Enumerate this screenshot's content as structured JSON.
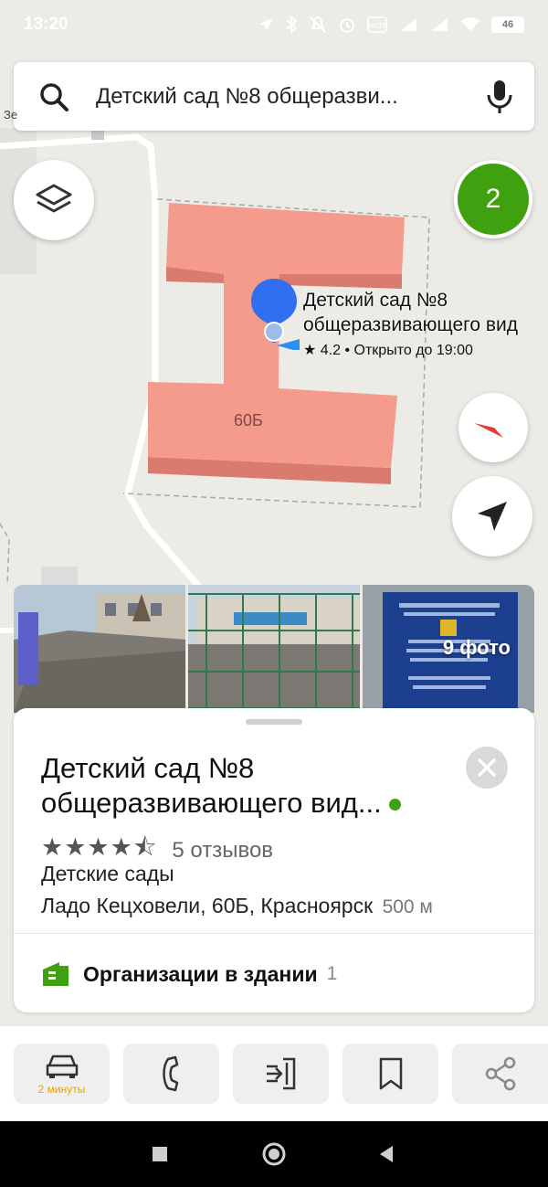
{
  "status_bar": {
    "time": "13:20",
    "battery": "46",
    "icons": [
      "location-arrow-icon",
      "bluetooth-icon",
      "mute-icon",
      "alarm-icon",
      "volte-icon",
      "signal-icon",
      "signal-icon",
      "wifi-icon",
      "battery-icon"
    ]
  },
  "search": {
    "query": "Детский сад №8 общеразви...",
    "icons": [
      "search-icon",
      "microphone-icon"
    ]
  },
  "map": {
    "badge_count": "2",
    "pin_title_line1": "Детский сад №8",
    "pin_title_line2": "общеразвивающего вид",
    "pin_rating": "★ 4.2",
    "pin_hours": "• Открыто до 19:00",
    "house_number": "60Б",
    "road_label": "Зе",
    "building_color": "#f59b8c"
  },
  "photos": {
    "count_label": "9 фото"
  },
  "card": {
    "title_line1": "Детский сад №8",
    "title_line2": "общеразвивающего вид...",
    "stars": "★★★★⯪",
    "reviews": "5 отзывов",
    "category": "Детские сады",
    "address": "Ладо Кецховели, 60Б, Красноярск",
    "distance": "500 м",
    "org_label": "Организации в здании",
    "org_count": "1",
    "status_color": "#3fa10f"
  },
  "actions": {
    "route_label": "2 минуты",
    "icons": [
      "car-icon",
      "phone-icon",
      "entrance-icon",
      "bookmark-icon",
      "share-icon"
    ]
  },
  "accent_colors": {
    "green": "#3fa10f",
    "pin_blue": "#2f6ff0",
    "route_yellow": "#e6a500"
  }
}
